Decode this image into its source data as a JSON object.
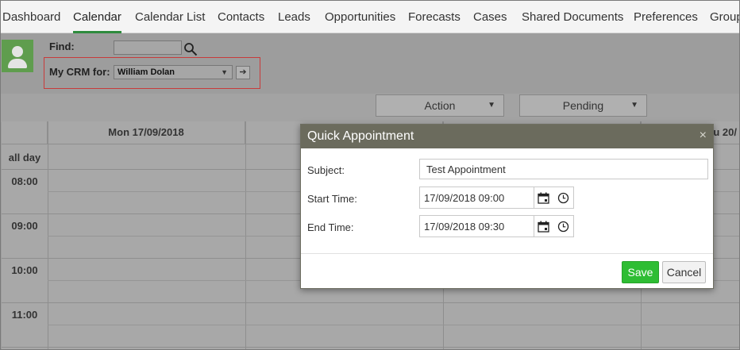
{
  "nav": {
    "items": [
      {
        "label": "Dashboard"
      },
      {
        "label": "Calendar",
        "active": true
      },
      {
        "label": "Calendar List"
      },
      {
        "label": "Contacts"
      },
      {
        "label": "Leads"
      },
      {
        "label": "Opportunities"
      },
      {
        "label": "Forecasts"
      },
      {
        "label": "Cases"
      },
      {
        "label": "Shared Documents"
      },
      {
        "label": "Preferences"
      },
      {
        "label": "Group"
      }
    ]
  },
  "filters": {
    "find_label": "Find:",
    "find_value": "",
    "crm_label": "My CRM for:",
    "crm_user": "William Dolan"
  },
  "toolbar": {
    "action_label": "Action",
    "status_label": "Pending"
  },
  "calendar": {
    "columns": [
      "Mon 17/09/2018",
      "",
      "",
      "u 20/"
    ],
    "all_day_label": "all day",
    "times": [
      "08:00",
      "09:00",
      "10:00",
      "11:00"
    ]
  },
  "modal": {
    "title": "Quick Appointment",
    "close_glyph": "×",
    "subject_label": "Subject:",
    "subject_value": "Test Appointment",
    "start_label": "Start Time:",
    "start_value": "17/09/2018 09:00",
    "end_label": "End Time:",
    "end_value": "17/09/2018 09:30",
    "save_label": "Save",
    "cancel_label": "Cancel"
  },
  "colors": {
    "accent_green": "#2e8b3d",
    "save_green": "#2ebd33",
    "modal_header": "#6b6b5d",
    "highlight_red": "#c83b3b"
  }
}
